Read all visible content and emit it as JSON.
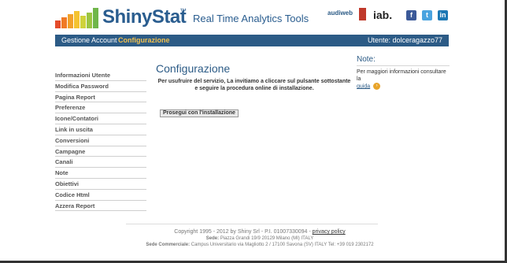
{
  "header": {
    "brand": "ShinyStat",
    "trademark": "™",
    "tagline": "Real Time Analytics Tools",
    "logo_bar_colors": [
      "#e44c2c",
      "#f07a26",
      "#f2a12a",
      "#f4c331",
      "#cfd23a",
      "#9bc541",
      "#6fb64a"
    ],
    "partners": [
      "audiweb",
      "iab."
    ],
    "social": [
      {
        "name": "facebook-icon",
        "letter": "f",
        "color": "#3b5998"
      },
      {
        "name": "twitter-icon",
        "letter": "t",
        "color": "#4aa3df"
      },
      {
        "name": "linkedin-icon",
        "letter": "in",
        "color": "#1d78b4"
      }
    ]
  },
  "nav": {
    "items": [
      {
        "label": "Gestione Account",
        "active": false
      },
      {
        "label": "Configurazione",
        "active": true
      }
    ],
    "user": "Utente: dolceragazzo77"
  },
  "sidebar": {
    "items": [
      {
        "label": "Informazioni Utente"
      },
      {
        "label": "Modifica Password"
      },
      {
        "label": "Pagina Report"
      },
      {
        "label": "Preferenze"
      },
      {
        "label": "Icone/Contatori"
      },
      {
        "label": "Link in uscita"
      },
      {
        "label": "Conversioni"
      },
      {
        "label": "Campagne"
      },
      {
        "label": "Canali"
      },
      {
        "label": "Note"
      },
      {
        "label": "Obiettivi"
      },
      {
        "label": "Codice Html"
      },
      {
        "label": "Azzera Report"
      }
    ]
  },
  "main": {
    "title": "Configurazione",
    "intro_line1": "Per usufruire del servizio, La invitiamo a cliccare sul pulsante sottostante",
    "intro_line2": "e seguire la procedura online di installazione.",
    "button": "Prosegui con l'installazione"
  },
  "note": {
    "title": "Note:",
    "text": "Per maggiori informazioni consultare la",
    "link": "guida"
  },
  "footer": {
    "copyright": "Copyright 1995 - 2012 by Shiny Srl - P.I. 01007330094 - ",
    "privacy": "privacy policy",
    "sede_label": "Sede:",
    "sede": " Piazza Grandi 19/9 20129 Milano (MI) ITALY",
    "commerciale_label": "Sede Commerciale:",
    "commerciale": " Campus Universitario via Magliotto 2 / 17100 Savona (SV) ITALY Tel: +39 019 2302172"
  }
}
